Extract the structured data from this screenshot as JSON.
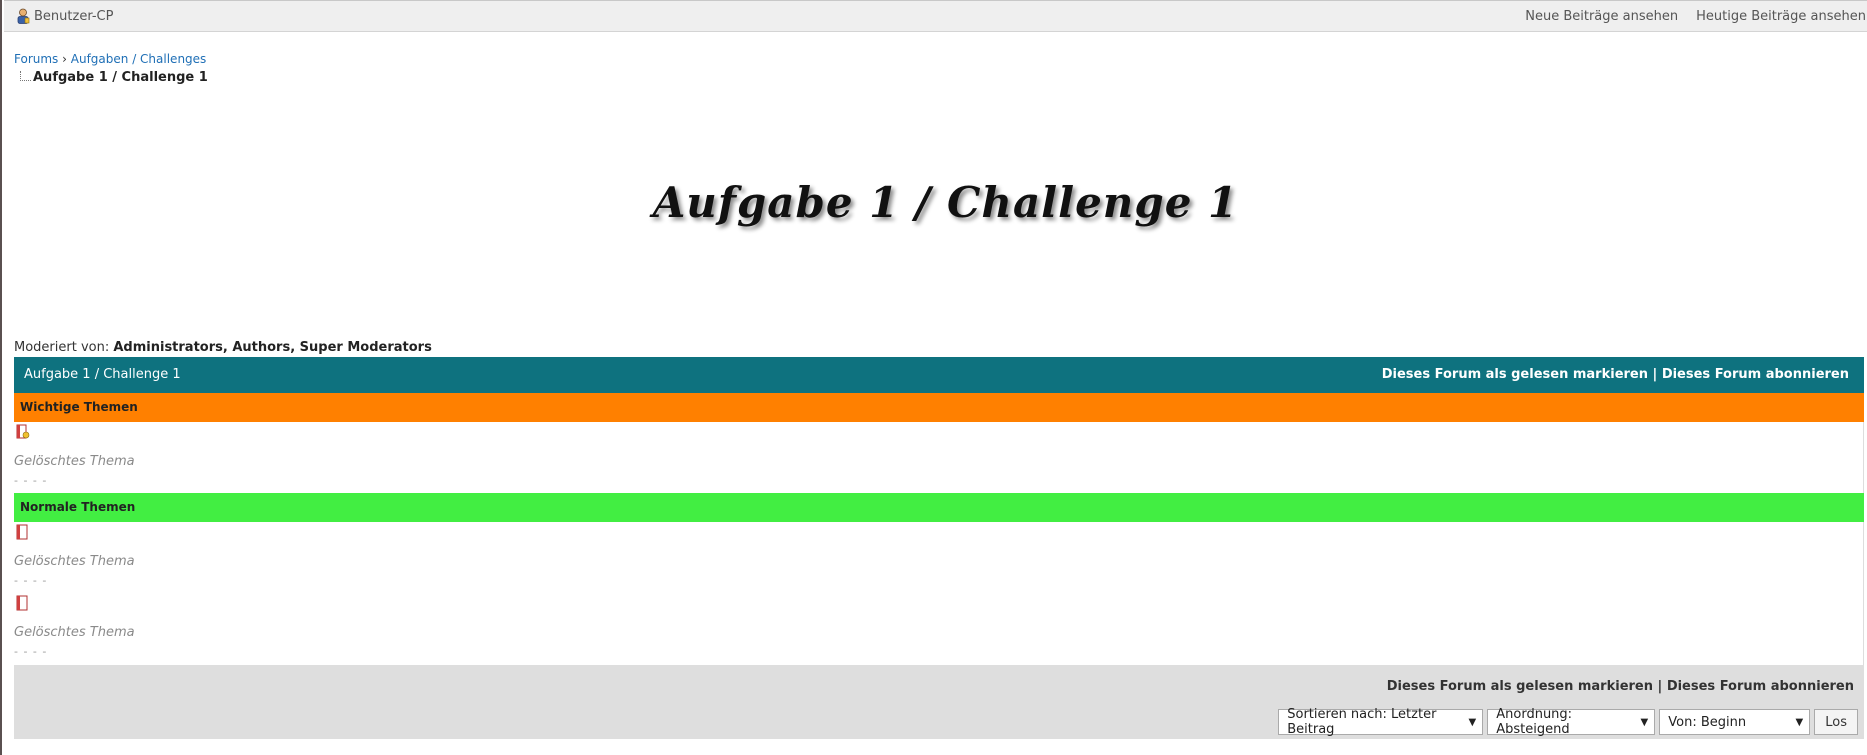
{
  "topbar": {
    "usercp_label": "Benutzer-CP",
    "nav": [
      "Neue Beiträge ansehen",
      "Heutige Beiträge ansehen"
    ]
  },
  "breadcrumb": {
    "items": [
      "Forums",
      "Aufgaben / Challenges"
    ],
    "separator": "›",
    "current": "Aufgabe 1 / Challenge 1"
  },
  "banner": {
    "title": "Aufgabe 1 / Challenge 1"
  },
  "moderated": {
    "label": "Moderiert von:",
    "moderators": "Administrators, Authors, Super Moderators"
  },
  "forum": {
    "title": "Aufgabe 1 / Challenge 1",
    "mark_read": "Dieses Forum als gelesen markieren",
    "divider": "|",
    "subscribe": "Dieses Forum abonnieren"
  },
  "sections": {
    "important": {
      "label": "Wichtige Themen",
      "color": "#ff8000",
      "threads": [
        {
          "title": "Gelöschtes Thema",
          "meta": "- - - -",
          "icon": "sticky-thread-icon"
        }
      ]
    },
    "normal": {
      "label": "Normale Themen",
      "color": "#42ee42",
      "threads": [
        {
          "title": "Gelöschtes Thema",
          "meta": "- - - -",
          "icon": "thread-icon"
        },
        {
          "title": "Gelöschtes Thema",
          "meta": "- - - -",
          "icon": "thread-icon"
        }
      ]
    }
  },
  "footer": {
    "mark_read": "Dieses Forum als gelesen markieren",
    "divider": "|",
    "subscribe": "Dieses Forum abonnieren",
    "sort_select": "Sortieren nach: Letzter Beitrag",
    "order_select": "Anordnung: Absteigend",
    "from_select": "Von: Beginn",
    "go_button": "Los"
  },
  "colors": {
    "header": "#0e727f",
    "link": "#1f6fb6"
  }
}
